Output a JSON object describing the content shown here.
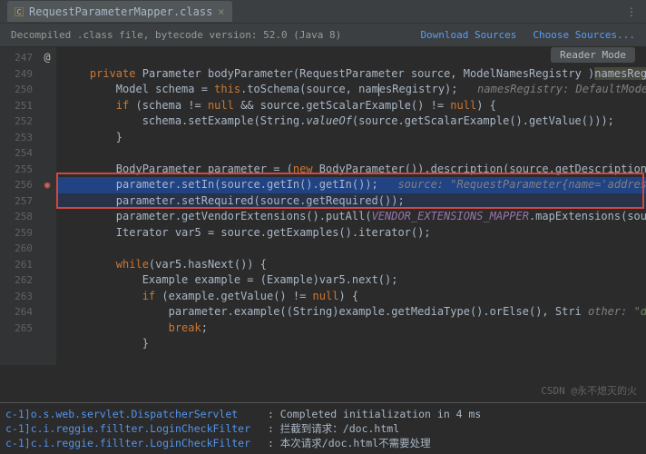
{
  "tab": {
    "filename": "RequestParameterMapper.class",
    "close_glyph": "×"
  },
  "banner": {
    "text": "Decompiled .class file, bytecode version: 52.0 (Java 8)",
    "download": "Download Sources",
    "choose": "Choose Sources..."
  },
  "reader_mode": "Reader Mode",
  "gutter": [
    "247",
    "",
    "249",
    "250",
    "251",
    "252",
    "253",
    "254",
    "255",
    "256",
    "257",
    "258",
    "259",
    "260",
    "261",
    "262",
    "263",
    "264",
    "265"
  ],
  "icons": {
    "at_row": 0,
    "at_glyph": "@",
    "bp_row": 8,
    "bp_glyph": "◉"
  },
  "code_lines": [
    {
      "t": ""
    },
    {
      "t": "    private Parameter bodyParameter(RequestParameter source, ModelNamesRegistry ",
      "hl_tail": "namesRegistry",
      "after": ")"
    },
    {
      "pre": "        Model schema = ",
      "this": "this",
      "mid": ".toSchema(source, nam",
      "caret": true,
      "mid2": "esRegistry);",
      "comment": "   namesRegistry: DefaultModelNames"
    },
    {
      "t": "        if (schema != null && source.getScalarExample() != null) {"
    },
    {
      "pre": "            schema.setExample(String.",
      "ital": "valueOf",
      "after": "(source.getScalarExample().getValue()));"
    },
    {
      "t": "        }"
    },
    {
      "t": ""
    },
    {
      "pre": "        BodyParameter parameter = (",
      "kw": "new",
      "after": " BodyParameter()).description(source.getDescription()).n"
    },
    {
      "hl": true,
      "t": "        parameter.setIn(source.getIn().getIn());",
      "comment": "   source: \"RequestParameter{name='addressBook"
    },
    {
      "hl2": true,
      "t": "        parameter.setRequired(source.getRequired());"
    },
    {
      "pre": "        parameter.getVendorExtensions().putAll(",
      "const": "VENDOR_EXTENSIONS_MAPPER",
      "after": ".mapExtensions(source.g"
    },
    {
      "t": "        Iterator var5 = source.getExamples().iterator();"
    },
    {
      "t": ""
    },
    {
      "t": "        while(var5.hasNext()) {"
    },
    {
      "t": "            Example example = (Example)var5.next();"
    },
    {
      "t": "            if (example.getValue() != null) {"
    },
    {
      "pre": "                parameter.example((String)example.getMediaType().orElse(",
      "comment": " other: ",
      "str": "\"default\"",
      "after": "), Stri"
    },
    {
      "pre": "                ",
      "kw": "break",
      "after": ";"
    },
    {
      "t": "            }"
    }
  ],
  "console": [
    {
      "cat": "c-1]",
      "cls": "o.s.web.servlet.DispatcherServlet",
      "msg": ": Completed initialization in 4 ms"
    },
    {
      "cat": "c-1]",
      "cls": "c.i.reggie.fillter.LoginCheckFilter",
      "msg": ": 拦截到请求：/doc.html"
    },
    {
      "cat": "c-1]",
      "cls": "c.i.reggie.fillter.LoginCheckFilter",
      "msg": ": 本次请求/doc.html不需要处理"
    }
  ],
  "watermark": "CSDN @永不熄灭的火"
}
